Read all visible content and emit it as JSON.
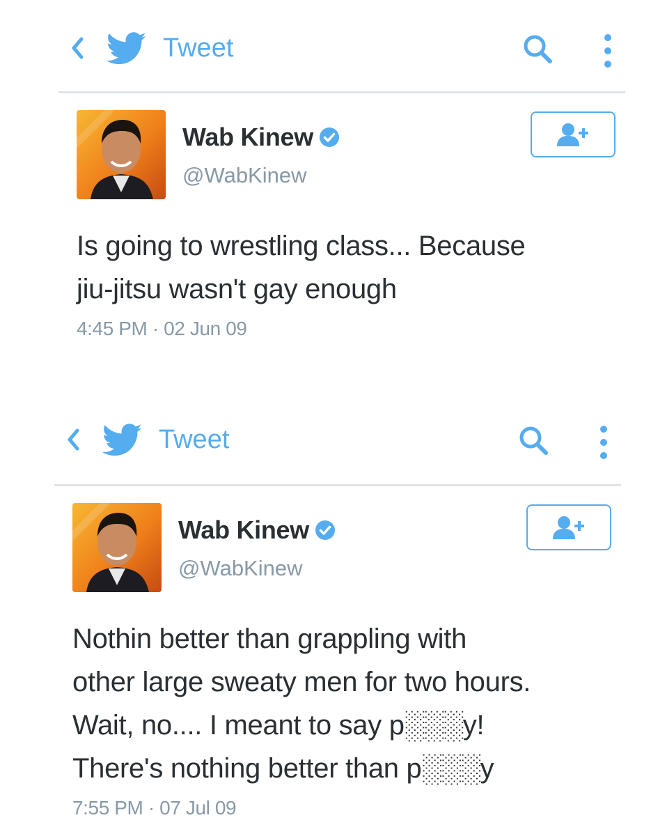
{
  "colors": {
    "accent": "#55acee",
    "text": "#292f33",
    "muted": "#8899a6",
    "divider": "#dfe3e7"
  },
  "icons": {
    "back": "chevron-left-icon",
    "logo": "twitter-bird-icon",
    "search": "search-icon",
    "more": "more-vertical-icon",
    "verified": "verified-badge-icon",
    "follow": "add-user-icon"
  },
  "tweets": [
    {
      "header": {
        "title": "Tweet"
      },
      "author": {
        "name": "Wab Kinew",
        "handle": "@WabKinew"
      },
      "text_lines": [
        "Is going to wrestling class... Because",
        "jiu-jitsu wasn't gay enough"
      ],
      "timestamp": "4:45 PM · 02 Jun 09"
    },
    {
      "header": {
        "title": "Tweet"
      },
      "author": {
        "name": "Wab Kinew",
        "handle": "@WabKinew"
      },
      "text_lines": [
        "Nothin better than grappling with",
        "other large sweaty men for two hours.",
        "Wait, no.... I meant to say p░░░y!",
        "There's nothing better than p░░░y"
      ],
      "timestamp": "7:55 PM · 07 Jul 09"
    }
  ]
}
